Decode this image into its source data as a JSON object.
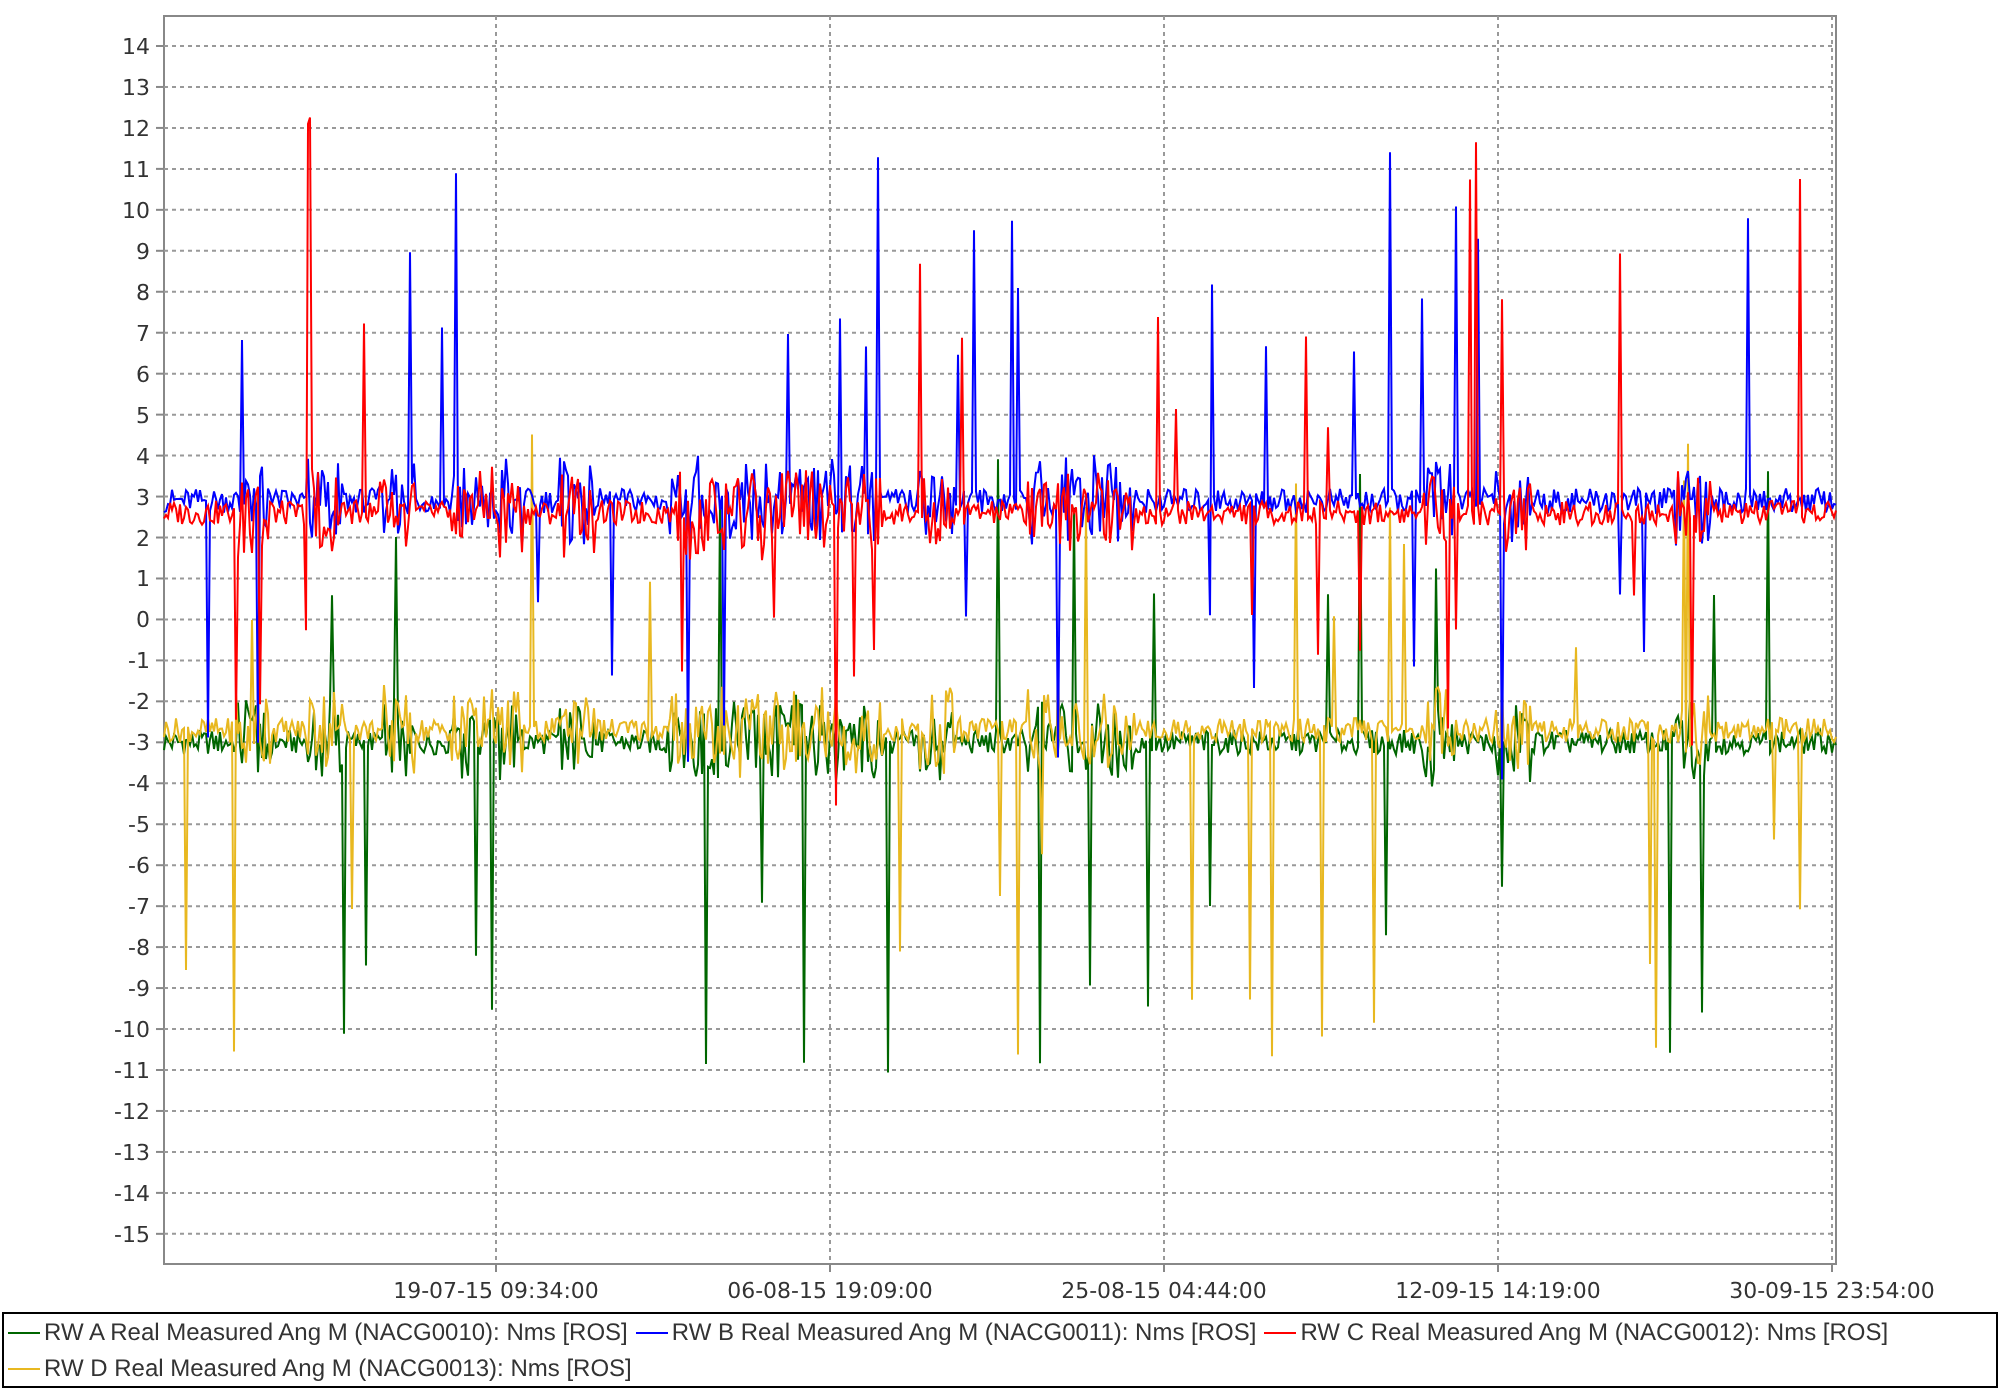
{
  "chart": {
    "y_ticks": [
      "14",
      "13",
      "12",
      "11",
      "10",
      "9",
      "8",
      "7",
      "6",
      "5",
      "4",
      "3",
      "2",
      "1",
      "0",
      "-1",
      "-2",
      "-3",
      "-4",
      "-5",
      "-6",
      "-7",
      "-8",
      "-9",
      "-10",
      "-11",
      "-12",
      "-13",
      "-14",
      "-15"
    ],
    "x_ticks": [
      "19-07-15 09:34:00",
      "06-08-15 19:09:00",
      "25-08-15 04:44:00",
      "12-09-15 14:19:00",
      "30-09-15 23:54:00"
    ]
  },
  "legend": [
    {
      "label": "RW A Real Measured Ang M (NACG0010): Nms [ROS]",
      "color": "#006600"
    },
    {
      "label": "RW B Real Measured Ang M (NACG0011): Nms [ROS]",
      "color": "#0000ff"
    },
    {
      "label": "RW C Real Measured Ang M (NACG0012): Nms [ROS]",
      "color": "#ff0000"
    },
    {
      "label": "RW D Real Measured Ang M (NACG0013): Nms [ROS]",
      "color": "#e8b820"
    }
  ]
}
